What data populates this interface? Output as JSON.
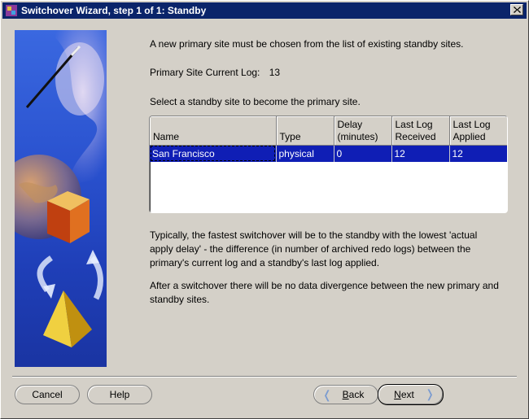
{
  "window": {
    "title": "Switchover Wizard, step 1 of 1: Standby"
  },
  "intro": "A new primary site must be chosen from the list of existing standby sites.",
  "current_log": {
    "label": "Primary Site Current Log:",
    "value": "13"
  },
  "select_prompt": "Select a standby site to become the primary site.",
  "table": {
    "headers": [
      [
        "Name"
      ],
      [
        "Type"
      ],
      [
        "Delay",
        "(minutes)"
      ],
      [
        "Last Log",
        "Received"
      ],
      [
        "Last Log",
        "Applied"
      ]
    ],
    "rows": [
      [
        "San Francisco",
        "physical",
        "0",
        "12",
        "12"
      ]
    ]
  },
  "info1": [
    "Typically, the fastest switchover will be to the standby with the lowest 'actual",
    "apply delay' - the difference (in number of archived redo logs) between the",
    "primary's current log and a standby's last log applied."
  ],
  "info2": [
    "After a switchover there will be no data divergence between the new primary and",
    "standby sites."
  ],
  "buttons": {
    "cancel": "Cancel",
    "help": "Help",
    "back_mnemonic": "B",
    "back_rest": "ack",
    "next_mnemonic": "N",
    "next_rest": "ext"
  }
}
